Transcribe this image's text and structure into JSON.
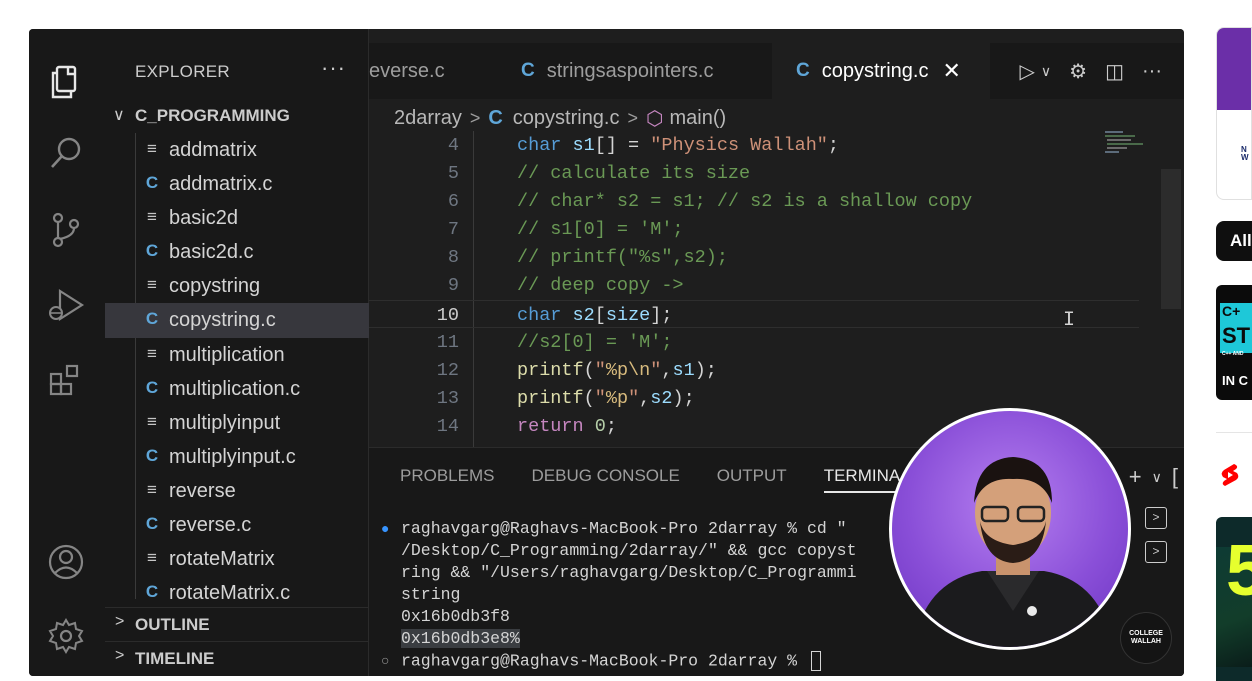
{
  "sidebar": {
    "title": "EXPLORER",
    "more": "···",
    "folder": "C_PROGRAMMING",
    "files": [
      {
        "name": "addmatrix",
        "type": "txt"
      },
      {
        "name": "addmatrix.c",
        "type": "c"
      },
      {
        "name": "basic2d",
        "type": "txt"
      },
      {
        "name": "basic2d.c",
        "type": "c"
      },
      {
        "name": "copystring",
        "type": "txt"
      },
      {
        "name": "copystring.c",
        "type": "c",
        "active": true
      },
      {
        "name": "multiplication",
        "type": "txt"
      },
      {
        "name": "multiplication.c",
        "type": "c"
      },
      {
        "name": "multiplyinput",
        "type": "txt"
      },
      {
        "name": "multiplyinput.c",
        "type": "c"
      },
      {
        "name": "reverse",
        "type": "txt"
      },
      {
        "name": "reverse.c",
        "type": "c"
      },
      {
        "name": "rotateMatrix",
        "type": "txt"
      },
      {
        "name": "rotateMatrix.c",
        "type": "c"
      }
    ],
    "sections": [
      "OUTLINE",
      "TIMELINE"
    ],
    "icon_c": "C",
    "icon_txt": "≡",
    "chevron_open": "∨",
    "chevron_closed": ">"
  },
  "tabs": [
    {
      "label": "everse.c",
      "icon": ""
    },
    {
      "label": "stringsaspointers.c",
      "icon": "C"
    },
    {
      "label": "copystring.c",
      "icon": "C",
      "active": true,
      "close": "✕"
    }
  ],
  "tab_actions": {
    "run": "▷",
    "run_menu": "∨",
    "settings": "⚙",
    "split": "◫",
    "more": "···"
  },
  "breadcrumb": {
    "folder": "2darray",
    "file_icon": "C",
    "file": "copystring.c",
    "symbol_icon": "⬡",
    "symbol": "main()",
    "sep": ">"
  },
  "code": {
    "current_line": 10,
    "lines": [
      {
        "n": 4,
        "tokens": [
          [
            "kw",
            "char"
          ],
          [
            "pl",
            " "
          ],
          [
            "id",
            "s1"
          ],
          [
            "pl",
            "[] = "
          ],
          [
            "str",
            "\"Physics Wallah\""
          ],
          [
            "pl",
            ";"
          ]
        ]
      },
      {
        "n": 5,
        "tokens": [
          [
            "cm",
            "// calculate its size"
          ]
        ]
      },
      {
        "n": 6,
        "tokens": [
          [
            "cm",
            "// char* s2 = s1; // s2 is a shallow copy"
          ]
        ]
      },
      {
        "n": 7,
        "tokens": [
          [
            "cm",
            "// s1[0] = 'M';"
          ]
        ]
      },
      {
        "n": 8,
        "tokens": [
          [
            "cm",
            "// printf(\"%s\",s2);"
          ]
        ]
      },
      {
        "n": 9,
        "tokens": [
          [
            "cm",
            "// deep copy ->"
          ]
        ]
      },
      {
        "n": 10,
        "tokens": [
          [
            "kw",
            "char"
          ],
          [
            "pl",
            " "
          ],
          [
            "id",
            "s2"
          ],
          [
            "pl",
            "["
          ],
          [
            "id",
            "size"
          ],
          [
            "pl",
            "];"
          ]
        ]
      },
      {
        "n": 11,
        "tokens": [
          [
            "cm",
            "//s2[0] = 'M';"
          ]
        ]
      },
      {
        "n": 12,
        "tokens": [
          [
            "fn",
            "printf"
          ],
          [
            "pl",
            "("
          ],
          [
            "str",
            "\""
          ],
          [
            "esc",
            "%p\\n"
          ],
          [
            "str",
            "\""
          ],
          [
            "pl",
            ","
          ],
          [
            "id",
            "s1"
          ],
          [
            "pl",
            ");"
          ]
        ]
      },
      {
        "n": 13,
        "tokens": [
          [
            "fn",
            "printf"
          ],
          [
            "pl",
            "("
          ],
          [
            "str",
            "\""
          ],
          [
            "esc",
            "%p"
          ],
          [
            "str",
            "\""
          ],
          [
            "pl",
            ","
          ],
          [
            "id",
            "s2"
          ],
          [
            "pl",
            ");"
          ]
        ]
      },
      {
        "n": 14,
        "tokens": [
          [
            "kw2",
            "return"
          ],
          [
            "pl",
            " "
          ],
          [
            "num",
            "0"
          ],
          [
            "pl",
            ";"
          ]
        ]
      }
    ]
  },
  "cursor_glyph": "I",
  "panel": {
    "tabs": [
      "PROBLEMS",
      "DEBUG CONSOLE",
      "OUTPUT",
      "TERMINA"
    ],
    "active_tab": "TERMINA",
    "actions": [
      "+",
      "∨",
      "["
    ],
    "dot_filled": "●",
    "dot_hollow": "○",
    "terminal_lines": [
      "raghavgarg@Raghavs-MacBook-Pro 2darray % cd \"",
      "/Desktop/C_Programming/2darray/\" && gcc copyst",
      "ring && \"/Users/raghavgarg/Desktop/C_Programmi",
      "string",
      "0x16b0db3f8",
      "0x16b0db3e8%",
      "raghavgarg@Raghavs-MacBook-Pro 2darray % "
    ],
    "side_buttons": [
      ">",
      ">"
    ]
  },
  "badge": {
    "line1": "COLLEGE",
    "line2": "WALLAH"
  },
  "right_strip": {
    "card_text_1": "N\nW",
    "pill": "All",
    "thumb_line1": "C+",
    "thumb_line2": "ST",
    "thumb_line3": "C++ AND",
    "thumb_line4": "IN C",
    "thumb_big": "5"
  },
  "colors": {
    "accent_c_icon": "#5fa6d8",
    "presenter_bg": "#8a4fd8",
    "youtube_red": "#ff0000"
  }
}
